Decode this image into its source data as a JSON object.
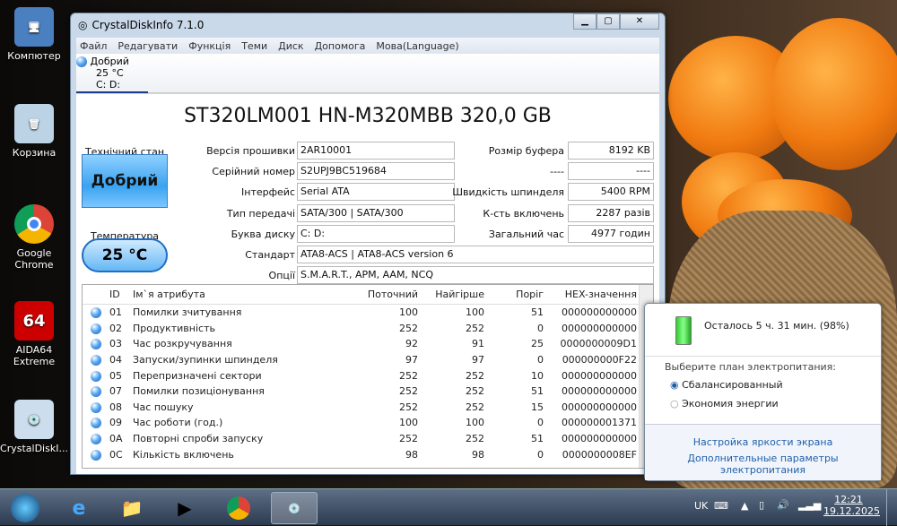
{
  "desktop": {
    "icons": [
      {
        "label": "Компютер"
      },
      {
        "label": "Корзина"
      },
      {
        "label": "Google Chrome"
      },
      {
        "label": "AIDA64 Extreme"
      },
      {
        "label": "CrystalDiskI..."
      }
    ]
  },
  "window": {
    "title": "CrystalDiskInfo 7.1.0",
    "menu": [
      "Файл",
      "Редагувати",
      "Функція",
      "Теми",
      "Диск",
      "Допомога",
      "Мова(Language)"
    ],
    "drive_tab": {
      "status": "Добрий",
      "temp": "25 °C",
      "letters": "C: D:"
    },
    "model": "ST320LM001 HN-M320MBB 320,0 GB",
    "health_label": "Технічний стан",
    "health_value": "Добрий",
    "temp_label": "Температура",
    "temp_value": "25 °C",
    "fields": {
      "firmware": {
        "label": "Версія прошивки",
        "value": "2AR10001"
      },
      "serial": {
        "label": "Серійний номер",
        "value": "S2UPJ9BC519684"
      },
      "interface": {
        "label": "Інтерфейс",
        "value": "Serial ATA"
      },
      "transfer": {
        "label": "Тип передачі",
        "value": "SATA/300 | SATA/300"
      },
      "letter": {
        "label": "Буква диску",
        "value": "C: D:"
      },
      "standard": {
        "label": "Стандарт",
        "value": "ATA8-ACS | ATA8-ACS version 6"
      },
      "features": {
        "label": "Опції",
        "value": "S.M.A.R.T., APM, AAM, NCQ"
      },
      "buffer": {
        "label": "Розмір буфера",
        "value": "8192 KB"
      },
      "blank": {
        "label": "----",
        "value": "----"
      },
      "rpm": {
        "label": "Швидкість шпинделя",
        "value": "5400 RPM"
      },
      "power_count": {
        "label": "К-сть включень",
        "value": "2287 разів"
      },
      "hours": {
        "label": "Загальний час",
        "value": "4977 годин"
      }
    },
    "table": {
      "headers": [
        "ID",
        "Ім`я атрибута",
        "Поточний",
        "Найгірше",
        "Поріг",
        "HEX-значення"
      ],
      "rows": [
        [
          "01",
          "Помилки зчитування",
          "100",
          "100",
          "51",
          "000000000000"
        ],
        [
          "02",
          "Продуктивність",
          "252",
          "252",
          "0",
          "000000000000"
        ],
        [
          "03",
          "Час розкручування",
          "92",
          "91",
          "25",
          "0000000009D1"
        ],
        [
          "04",
          "Запуски/зупинки шпинделя",
          "97",
          "97",
          "0",
          "000000000F22"
        ],
        [
          "05",
          "Перепризначені сектори",
          "252",
          "252",
          "10",
          "000000000000"
        ],
        [
          "07",
          "Помилки позиціонування",
          "252",
          "252",
          "51",
          "000000000000"
        ],
        [
          "08",
          "Час пошуку",
          "252",
          "252",
          "15",
          "000000000000"
        ],
        [
          "09",
          "Час роботи (год.)",
          "100",
          "100",
          "0",
          "000000001371"
        ],
        [
          "0A",
          "Повторні спроби запуску",
          "252",
          "252",
          "51",
          "000000000000"
        ],
        [
          "0C",
          "Кількість включень",
          "98",
          "98",
          "0",
          "0000000008EF"
        ]
      ]
    }
  },
  "power_popup": {
    "remaining": "Осталось 5 ч. 31 мин. (98%)",
    "battery_percent": 98,
    "plan_prompt": "Выберите план электропитания:",
    "plans": [
      {
        "label": "Сбалансированный",
        "selected": true
      },
      {
        "label": "Экономия энергии",
        "selected": false
      }
    ],
    "link_brightness": "Настройка яркости экрана",
    "link_more": "Дополнительные параметры электропитания"
  },
  "tray": {
    "lang": "UK",
    "time": "12:21",
    "date": "19.12.2025"
  }
}
